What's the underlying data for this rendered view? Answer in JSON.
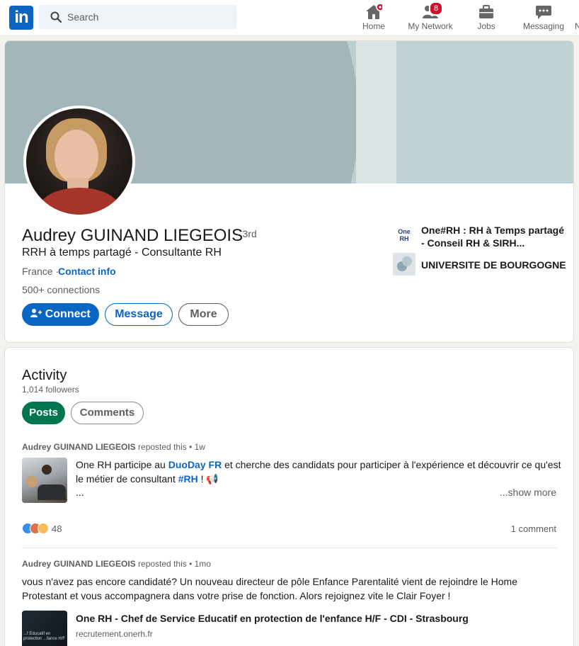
{
  "nav": {
    "logo_text": "in",
    "search_placeholder": "Search",
    "items": [
      {
        "label": "Home",
        "icon": "home-icon",
        "badge": ""
      },
      {
        "label": "My Network",
        "icon": "network-icon",
        "badge": "8"
      },
      {
        "label": "Jobs",
        "icon": "briefcase-icon",
        "badge": ""
      },
      {
        "label": "Messaging",
        "icon": "messaging-icon",
        "badge": ""
      }
    ],
    "overflow_label": "N"
  },
  "profile": {
    "name": "Audrey GUINAND LIEGEOIS",
    "degree": "· 3rd",
    "headline": "RRH à temps partagé - Consultante RH",
    "location": "France ·",
    "contact_label": "Contact info",
    "connections": "500+ connections",
    "buttons": {
      "connect": "Connect",
      "message": "Message",
      "more": "More"
    },
    "organizations": [
      {
        "name": "One#RH : RH à Temps partagé - Conseil RH & SIRH...",
        "logo_text": "One RH"
      },
      {
        "name": "UNIVERSITE DE BOURGOGNE",
        "logo_text": ""
      }
    ]
  },
  "activity": {
    "title": "Activity",
    "followers": "1,014 followers",
    "tabs": {
      "posts": "Posts",
      "comments": "Comments"
    },
    "posts": [
      {
        "author": "Audrey GUINAND LIEGEOIS",
        "meta": "reposted this • 1w",
        "text_before": "One RH participe au ",
        "link1": "DuoDay FR",
        "text_middle": " et cherche des candidats pour participer à l'expérience et découvrir ce qu'est le métier de consultant ",
        "link2": "#RH",
        "text_after": " ! 📢",
        "ellipsis": "...",
        "show_more": "...show more",
        "reaction_count": "48",
        "comments": "1 comment"
      },
      {
        "author": "Audrey GUINAND LIEGEOIS",
        "meta": "reposted this • 1mo",
        "text": "vous n'avez pas encore candidaté? Un nouveau directeur de pôle Enfance Parentalité vient de rejoindre le Home Protestant et vous accompagnera dans votre prise de fonction. Alors rejoignez vite le Clair Foyer !",
        "link_title": "One RH - Chef de Service Educatif en protection de l'enfance H/F - CDI - Strasbourg",
        "link_domain": "recrutement.onerh.fr",
        "thumb_text": "...f Educatif en protection ...fance H/F"
      }
    ]
  },
  "colors": {
    "brand": "#0a66c2",
    "posts_pill": "#01754f",
    "badge": "#cb112d"
  }
}
